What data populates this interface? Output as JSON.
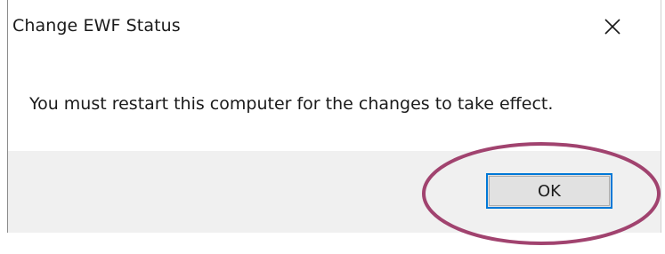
{
  "dialog": {
    "title": "Change EWF Status",
    "message": "You must restart this computer for the changes to take effect.",
    "ok_label": "OK"
  },
  "icons": {
    "close": "close-icon"
  },
  "colors": {
    "footer_bg": "#f0f0f0",
    "button_focus": "#0078d7",
    "highlight_ring": "#a1436f"
  }
}
